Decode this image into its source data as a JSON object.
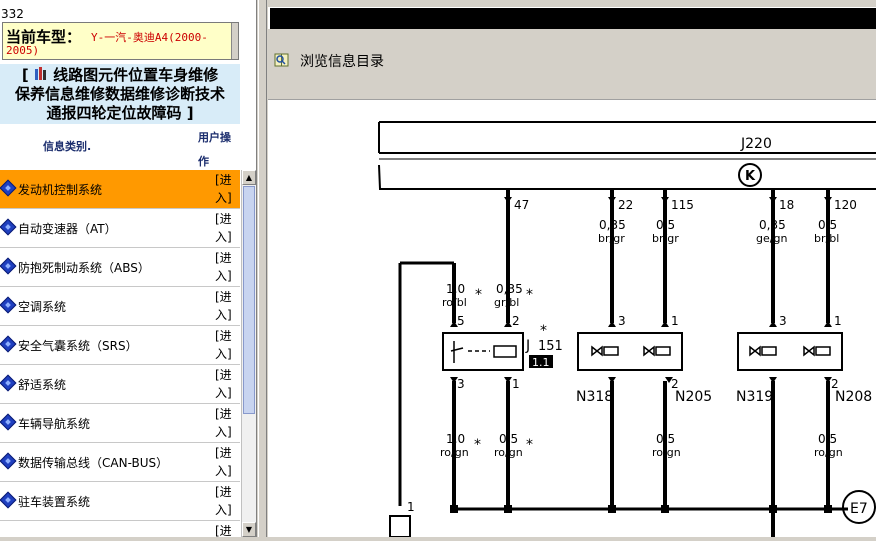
{
  "left_panel": {
    "top_number": "332",
    "car_label": "当前车型：",
    "car_value_line1": "Y-一汽-奥迪A4(2000-",
    "car_value_line2": "2005)",
    "nav_links_line1": "线路图元件位置车身维修",
    "nav_links_line2": "保养信息维修数据维修诊断技术",
    "nav_links_line3": "通报四轮定位故障码",
    "bracket_open": "[",
    "bracket_close": "]",
    "table_header": {
      "category": "信息类别.",
      "action_line1": "用户操",
      "action_line2": "作"
    },
    "enter_line1": "[进",
    "enter_line2": "入]",
    "rows": [
      {
        "label": "发动机控制系统",
        "active": true
      },
      {
        "label": "自动变速器（AT）",
        "active": false
      },
      {
        "label": "防抱死制动系统（ABS）",
        "active": false
      },
      {
        "label": "空调系统",
        "active": false
      },
      {
        "label": "安全气囊系统（SRS）",
        "active": false
      },
      {
        "label": "舒适系统",
        "active": false
      },
      {
        "label": "车辆导航系统",
        "active": false
      },
      {
        "label": "数据传输总线（CAN-BUS）",
        "active": false
      },
      {
        "label": "驻车装置系统",
        "active": false
      },
      {
        "label": "",
        "active": false
      }
    ],
    "colors": {
      "active_row": "#ff9900",
      "car_value": "#cc0000",
      "nav_bg": "#d8ecf8"
    }
  },
  "right_panel": {
    "browse_label": "浏览信息目录",
    "browse_icon": "magnifier-book-icon"
  },
  "diagram": {
    "labels": {
      "j220": "J220",
      "k": "K",
      "p47": "47",
      "p22": "22",
      "p115": "115",
      "p18": "18",
      "p120": "120",
      "w1a": "0,35",
      "w1b": "br/gr",
      "w2a": "0,5",
      "w2b": "br/gr",
      "w3a": "0,35",
      "w3b": "ge/gn",
      "w4a": "0,5",
      "w4b": "br/bl",
      "w5a": "1,0",
      "w5b": "ro/bl",
      "w6a": "0,35",
      "w6b": "gr/bl",
      "star": "*",
      "p5": "5",
      "p2": "2",
      "p3a": "3",
      "p1a": "1",
      "p3b": "3",
      "p1b": "1",
      "j151": "J",
      "j151b": "151",
      "j151c": "1.1",
      "p3c": "3",
      "p1c": "1",
      "p2a": "2",
      "p2b": "2",
      "n318": "N318",
      "n205": "N205",
      "n319": "N319",
      "n208": "N208",
      "w7a": "1,0",
      "w7b": "ro/gn",
      "w8a": "0,5",
      "w8b": "ro/gn",
      "w9a": "0,5",
      "w9b": "ro/gn",
      "w10a": "0,5",
      "w10b": "ro/gn",
      "e7": "E7",
      "p1d": "1"
    }
  }
}
